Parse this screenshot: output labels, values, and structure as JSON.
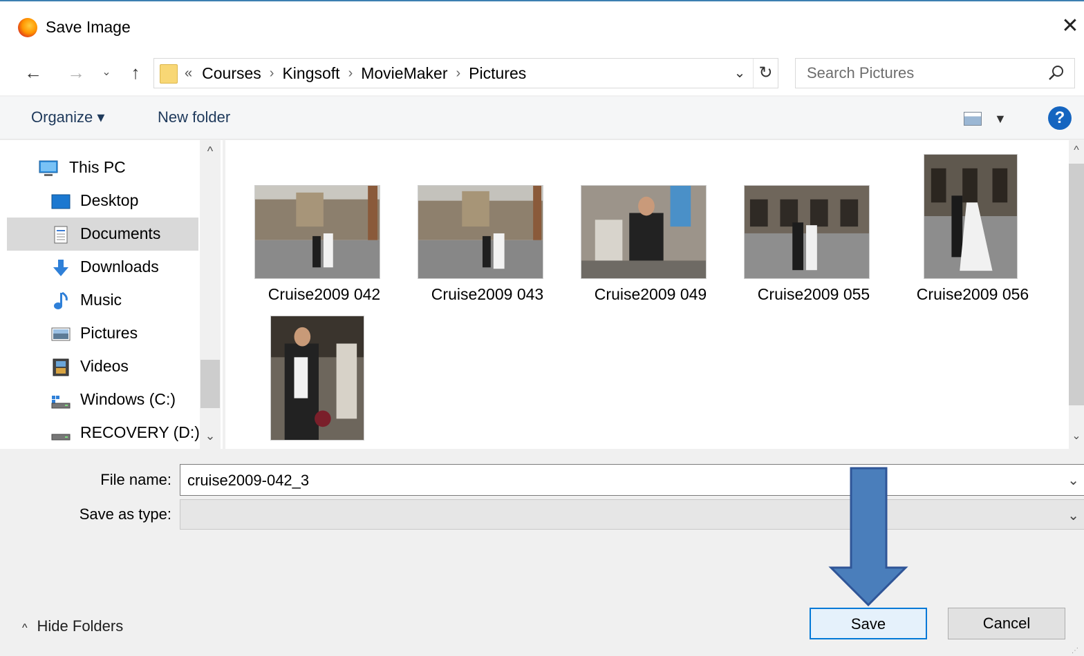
{
  "window": {
    "title": "Save Image"
  },
  "address": {
    "overflow": "«",
    "crumbs": [
      "Courses",
      "Kingsoft",
      "MovieMaker",
      "Pictures"
    ]
  },
  "search": {
    "placeholder": "Search Pictures"
  },
  "toolbar": {
    "organize_label": "Organize ▾",
    "new_folder_label": "New folder"
  },
  "sidebar": {
    "items": [
      {
        "label": "This PC",
        "icon": "computer-icon"
      },
      {
        "label": "Desktop",
        "icon": "desktop-icon"
      },
      {
        "label": "Documents",
        "icon": "documents-icon",
        "selected": true
      },
      {
        "label": "Downloads",
        "icon": "downloads-icon"
      },
      {
        "label": "Music",
        "icon": "music-icon"
      },
      {
        "label": "Pictures",
        "icon": "pictures-icon"
      },
      {
        "label": "Videos",
        "icon": "videos-icon"
      },
      {
        "label": "Windows (C:)",
        "icon": "drive-c-icon"
      },
      {
        "label": "RECOVERY (D:)",
        "icon": "drive-d-icon"
      }
    ]
  },
  "files": [
    {
      "name": "Cruise2009 042"
    },
    {
      "name": "Cruise2009 043"
    },
    {
      "name": "Cruise2009 049"
    },
    {
      "name": "Cruise2009 055"
    },
    {
      "name": "Cruise2009 056"
    },
    {
      "name": ""
    }
  ],
  "form": {
    "file_name_label": "File name:",
    "file_name_value": "cruise2009-042_3",
    "save_as_type_label": "Save as type:",
    "save_as_type_value": ""
  },
  "footer": {
    "hide_folders_label": "Hide Folders",
    "save_label": "Save",
    "cancel_label": "Cancel"
  },
  "colors": {
    "accent": "#0078d7",
    "arrow_fill": "#4a7ebb",
    "arrow_stroke": "#2f5597"
  }
}
